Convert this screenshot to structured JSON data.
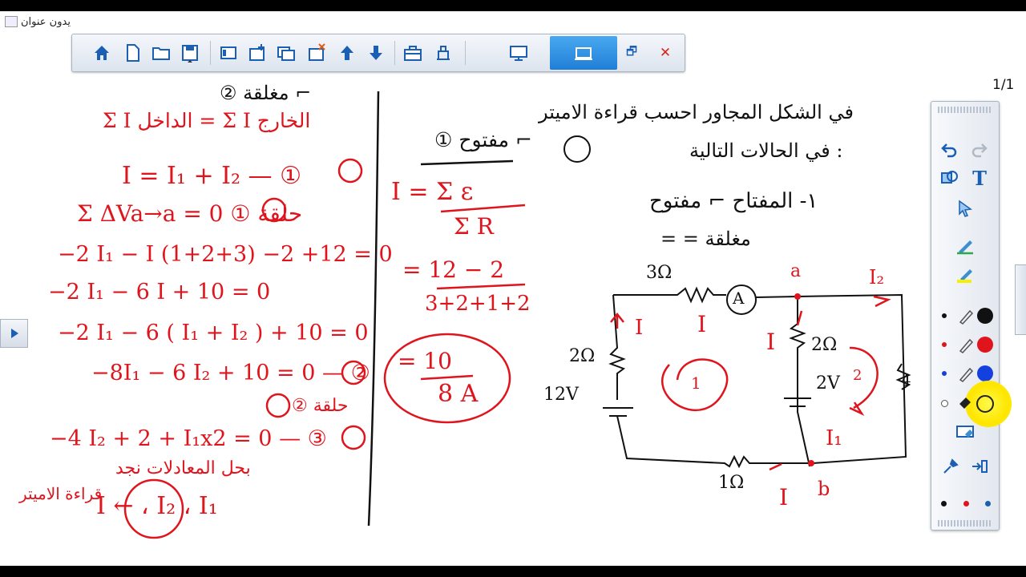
{
  "window": {
    "title": "يدون عنوان"
  },
  "toolbar": {
    "buttons": [
      "home-icon",
      "new-page-icon",
      "open-icon",
      "save-icon",
      "page-sort-icon",
      "add-page-icon",
      "duplicate-page-icon",
      "delete-page-icon",
      "page-up-icon",
      "page-down-icon",
      "toolbox-icon",
      "print-icon",
      "display-icon",
      "fullscreen-icon"
    ],
    "minimize_label": "🗗",
    "close_label": "✕"
  },
  "page_indicator": "1/1",
  "colors": {
    "accent": "#1f7fd6",
    "ink_red": "#e0141c",
    "ink_black": "#111111",
    "highlight": "#ffff00"
  },
  "board": {
    "left_column": [
      "② مغلقة ⌐",
      "Σ I الداخل = Σ I الخارج",
      "I = I₁ + I₂ — ①",
      "Σ ΔVa→a = 0  ① حلقة",
      "−2 I₁ − I (1+2+3) −2 +12 = 0",
      "−2 I₁ − 6 I + 10 = 0",
      "−2 I₁ − 6 ( I₁ + I₂ ) + 10 = 0",
      "−8I₁ − 6 I₂ + 10 = 0 — ②",
      "② حلقة",
      "−4 I₂ + 2 + I₁x2 = 0 — ③",
      "بحل المعادلات نجد",
      "قراءة الاميتر",
      "I ← ، I₂ ، I₁"
    ],
    "middle_column": [
      "① مفتوح ⌐",
      "I = Σ ε",
      "Σ R",
      "= 12 − 2",
      "3+2+1+2",
      "= 10",
      "8 A"
    ],
    "right_header": [
      "في الشكل المجاور احسب قراءة الاميتر",
      "في الحالات التالية :",
      "١- المفتاح ⌐ مفتوح",
      "= = مغلقة"
    ],
    "circuit": {
      "labels": [
        "3Ω",
        "A",
        "a",
        "I₂",
        "I",
        "I",
        "I",
        "2Ω",
        "2Ω",
        "2V",
        "12V",
        "1",
        "2",
        "I₁",
        "1Ω",
        "I",
        "b",
        "4"
      ]
    }
  },
  "palette": {
    "tools": [
      "undo-icon",
      "redo-icon",
      "shapes-icon",
      "text-icon",
      "select-icon",
      "green-pen-icon",
      "highlighter-icon",
      "black-pen-icon",
      "red-pen-icon",
      "blue-pen-icon",
      "yellow-marker-icon",
      "eraser-icon",
      "pin-icon",
      "dock-icon"
    ]
  }
}
